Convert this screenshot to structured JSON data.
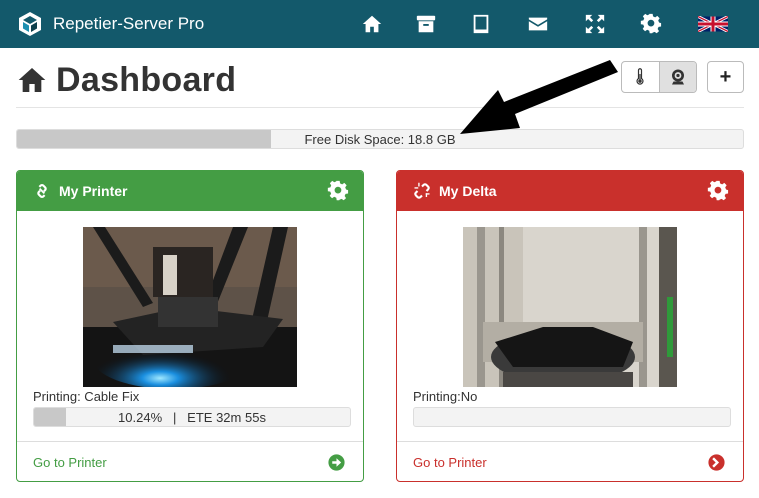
{
  "app": {
    "title": "Repetier-Server Pro"
  },
  "nav": {
    "icons": [
      "home-icon",
      "archive-icon",
      "tablet-icon",
      "envelope-icon",
      "fullscreen-icon",
      "gear-icon",
      "uk-flag-icon"
    ]
  },
  "page": {
    "title": "Dashboard"
  },
  "header_buttons": {
    "add_label": "+"
  },
  "disk": {
    "label": "Free Disk Space: 18.8 GB",
    "used_fraction": 0.35
  },
  "colors": {
    "navbar": "#13596b",
    "printer1": "#449d44",
    "printer2": "#c9302c"
  },
  "printers": [
    {
      "name": "My Printer",
      "status": "Printing: Cable Fix",
      "progress_text": "10.24%   |   ETE 32m 55s",
      "progress": 0.1024,
      "link": "Go to Printer",
      "color": "#449d44"
    },
    {
      "name": "My Delta",
      "status": "Printing:No",
      "progress_text": "",
      "progress": 0,
      "link": "Go to Printer",
      "color": "#c9302c"
    }
  ]
}
